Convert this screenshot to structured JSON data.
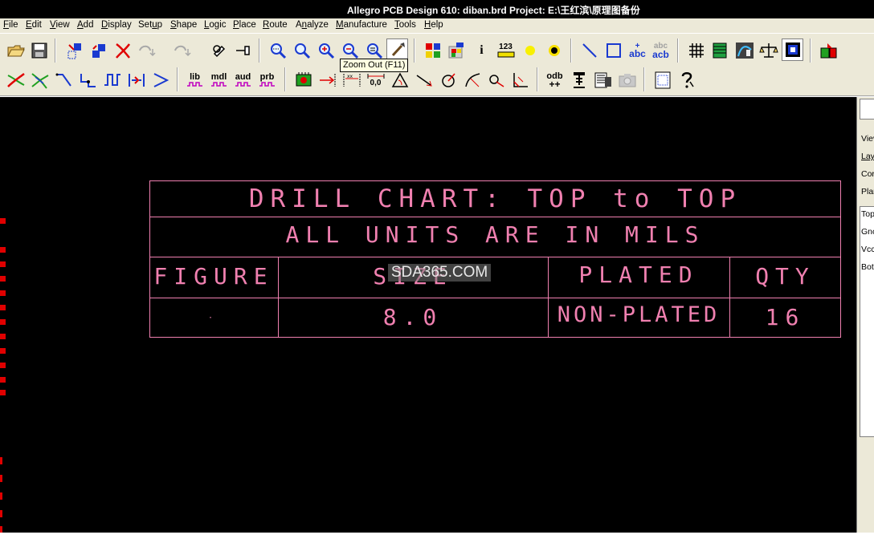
{
  "window": {
    "title": "Allegro PCB Design 610: diban.brd  Project: E:\\王红滨\\原理图备份"
  },
  "menu": [
    {
      "label": "File",
      "key": "F"
    },
    {
      "label": "Edit",
      "key": "E"
    },
    {
      "label": "View",
      "key": "V"
    },
    {
      "label": "Add",
      "key": "A"
    },
    {
      "label": "Display",
      "key": "D"
    },
    {
      "label": "Setup",
      "key": "u"
    },
    {
      "label": "Shape",
      "key": "S"
    },
    {
      "label": "Logic",
      "key": "L"
    },
    {
      "label": "Place",
      "key": "P"
    },
    {
      "label": "Route",
      "key": "R"
    },
    {
      "label": "Analyze",
      "key": "n"
    },
    {
      "label": "Manufacture",
      "key": "M"
    },
    {
      "label": "Tools",
      "key": "T"
    },
    {
      "label": "Help",
      "key": "H"
    }
  ],
  "toolbar": {
    "tooltip": "Zoom Out (F11)",
    "text_buttons": {
      "info": "i",
      "count": "123",
      "add_text": "abc",
      "change_text_top": "abc",
      "change_text_bottom": "acb",
      "lib": "lib",
      "mdl": "mdl",
      "aud": "aud",
      "prb": "prb",
      "dim_origin": "0,0",
      "odb": "odb",
      "odb_sub": "++"
    }
  },
  "drill_chart": {
    "title": "DRILL CHART: TOP to TOP",
    "units": "ALL UNITS ARE IN MILS",
    "headers": [
      "FIGURE",
      "SIZE",
      "PLATED",
      "QTY"
    ],
    "rows": [
      {
        "figure": "·",
        "size": "8.0",
        "plated": "NON-PLATED",
        "qty": "16"
      }
    ]
  },
  "watermark": "SDA365.COM",
  "right_panel": {
    "items": [
      "Viev",
      "Lay",
      "Cor",
      "Plar",
      "Top",
      "Gnc",
      "Vcc",
      "Bot"
    ]
  },
  "colors": {
    "canvas": "#000000",
    "chart_lines": "#f080b0",
    "pins": "#e00000",
    "chrome": "#ece9d8"
  }
}
